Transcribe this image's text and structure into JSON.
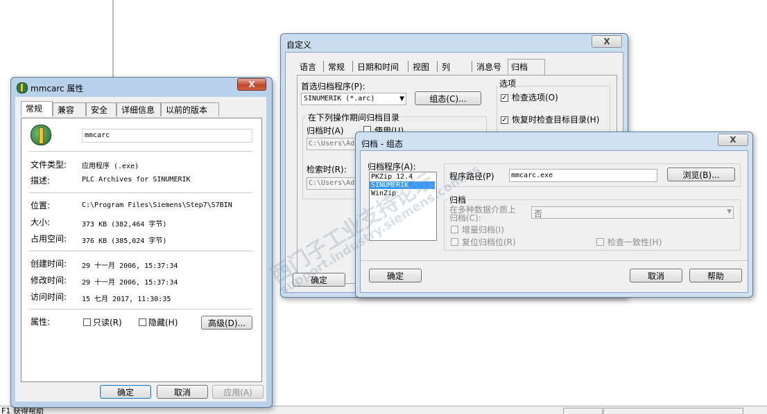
{
  "props_window": {
    "title": "mmcarc 属性",
    "close": "X",
    "tabs": [
      "常规",
      "兼容性",
      "安全",
      "详细信息",
      "以前的版本"
    ],
    "filename": "mmcarc",
    "rows": [
      {
        "label": "文件类型:",
        "value": "应用程序 (.exe)"
      },
      {
        "label": "描述:",
        "value": "PLC Archives for SINUMERIK"
      },
      {
        "label": "位置:",
        "value": "C:\\Program Files\\Siemens\\Step7\\S7BIN"
      },
      {
        "label": "大小:",
        "value": "373 KB (382,464 字节)"
      },
      {
        "label": "占用空间:",
        "value": "376 KB (385,024 字节)"
      },
      {
        "label": "创建时间:",
        "value": "29 十一月 2006, 15:37:34"
      },
      {
        "label": "修改时间:",
        "value": "29 十一月 2006, 15:37:34"
      },
      {
        "label": "访问时间:",
        "value": "15 七月 2017, 11:30:35"
      }
    ],
    "attr_label": "属性:",
    "readonly_label": "只读(R)",
    "hidden_label": "隐藏(H)",
    "advanced_btn": "高级(D)...",
    "ok_btn": "确定",
    "cancel_btn": "取消",
    "apply_btn": "应用(A)"
  },
  "custom_window": {
    "title": "自定义",
    "close": "X",
    "tabs": [
      "语言",
      "常规",
      "日期和时间",
      "视图",
      "列",
      "消息号",
      "归档"
    ],
    "pref_prog_label": "首选归档程序(P):",
    "pref_prog_value": "SINUMERIK (*.arc)",
    "config_btn": "组态(C)...",
    "options_group": "选项",
    "check_option": "检查选项(O)",
    "restore_check": "恢复时检查目标目录(H)",
    "archive_dir_group": "在下列操作期间归档目录",
    "archive_when": "归档时(A)",
    "use_label": "使用(U)",
    "path1": "C:\\Users\\Ad",
    "retrieve_when": "检索时(R):",
    "path2": "C:\\Users\\Ad",
    "ok_btn": "确定"
  },
  "archive_window": {
    "title": "归档 - 组态",
    "close": "X",
    "programs_label": "归档程序(A):",
    "programs": [
      "PKZip 12.4",
      "SINUMERIK",
      "WinZip"
    ],
    "selected_index": 1,
    "path_label": "程序路径(P)",
    "path_value": "mmcarc.exe",
    "browse_btn": "浏览(B)...",
    "archive_group": "归档",
    "multi_media_label_1": "在多种数据介质上",
    "multi_media_label_2": "归档(C):",
    "multi_media_value": "否",
    "incremental": "增量归档(I)",
    "reset_bit": "复位归档位(R)",
    "check_consistency": "检查一致性(H)",
    "ok_btn": "确定",
    "cancel_btn": "取消",
    "help_btn": "帮助"
  },
  "status_bar": {
    "text": "F1 获得帮助"
  },
  "watermark": {
    "text_1": "西门子工业支持论坛",
    "text_2": "support.industry.siemens.com/cs"
  }
}
